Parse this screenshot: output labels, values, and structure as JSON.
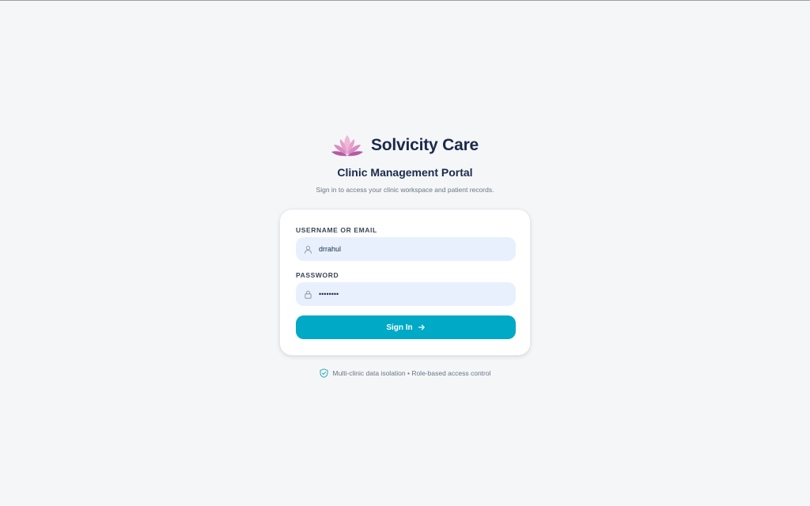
{
  "brand": {
    "name": "Solvicity Care",
    "logo_icon": "lotus-icon",
    "logo_colors": [
      "#f0b7d8",
      "#d98bc2",
      "#b65aa3"
    ]
  },
  "portal": {
    "title": "Clinic Management Portal",
    "subtitle": "Sign in to access your clinic workspace and patient records."
  },
  "form": {
    "username": {
      "label": "USERNAME OR EMAIL",
      "value": "drrahul",
      "icon": "user-icon"
    },
    "password": {
      "label": "PASSWORD",
      "value": "••••••••",
      "icon": "lock-icon"
    },
    "submit": {
      "label": "Sign In",
      "icon": "arrow-right-icon"
    }
  },
  "footer": {
    "icon": "shield-check-icon",
    "text": "Multi-clinic data isolation • Role-based access control"
  },
  "colors": {
    "background": "#f4f6f8",
    "brand_text": "#1b2a4a",
    "accent": "#00a9c6",
    "input_bg": "#e8f0fd",
    "muted_text": "#6b7685"
  }
}
